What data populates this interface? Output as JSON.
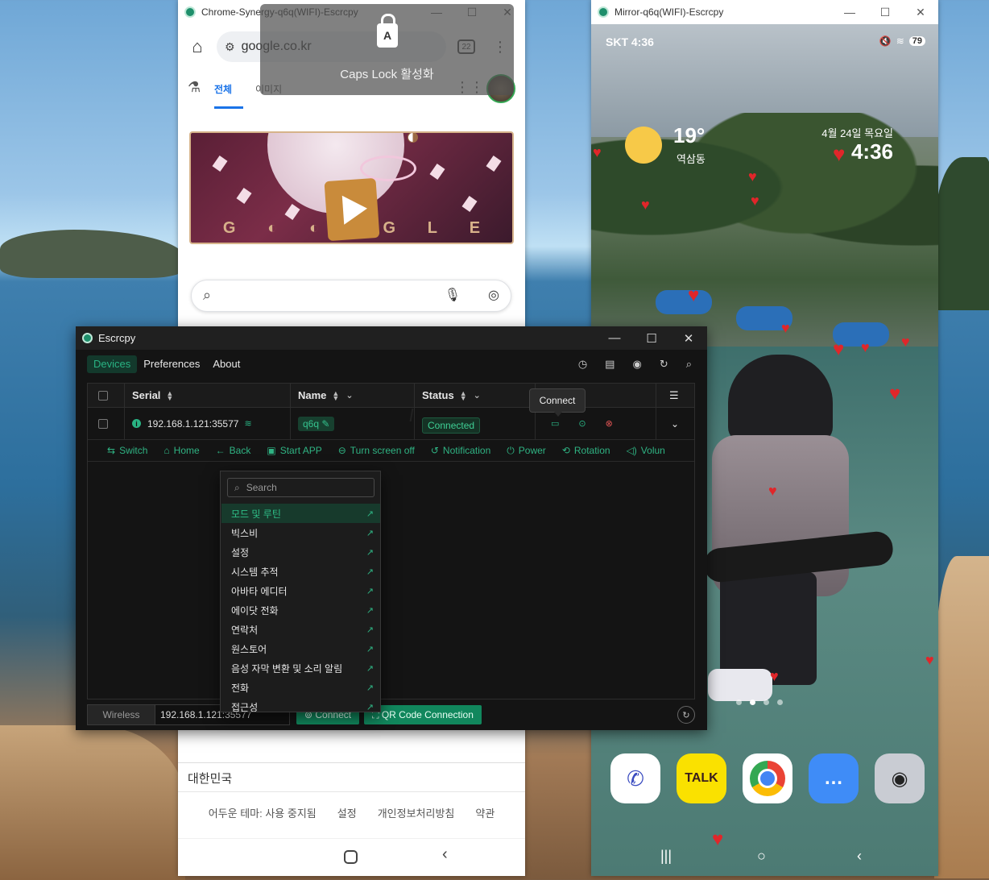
{
  "chrome_window": {
    "title": "Chrome-Synergy-q6q(WIFI)-Escrcpy",
    "url": "google.co.kr",
    "tab_count": "22",
    "tabs": [
      "전체",
      "이미지"
    ],
    "doodle_word": [
      "G",
      "◐",
      "◐",
      "G",
      "L",
      "E"
    ],
    "country": "대한민국",
    "footer_links": [
      "어두운 테마: 사용 중지됨",
      "설정",
      "개인정보처리방침",
      "약관"
    ]
  },
  "capslock_toast": {
    "key_letter": "A",
    "message": "Caps Lock 활성화"
  },
  "mirror_window": {
    "title": "Mirror-q6q(WIFI)-Escrcpy",
    "carrier_time": "SKT 4:36",
    "battery": "79",
    "weather_temp": "19°",
    "weather_location": "역삼동",
    "date": "4월 24일 목요일",
    "clock": "4:36",
    "dock_apps": [
      {
        "name": "phone",
        "icon": "phone-icon",
        "label": ""
      },
      {
        "name": "kakaotalk",
        "icon": "talk-icon",
        "label": "TALK"
      },
      {
        "name": "chrome",
        "icon": "chrome-icon",
        "label": ""
      },
      {
        "name": "messages",
        "icon": "chat-bubble-icon",
        "label": ""
      },
      {
        "name": "camera",
        "icon": "camera-icon",
        "label": ""
      }
    ]
  },
  "escrcpy": {
    "title": "Escrcpy",
    "menu": [
      "Devices",
      "Preferences",
      "About"
    ],
    "active_menu": "Devices",
    "toolbar_icons": [
      "history-icon",
      "terminal-icon",
      "eye-icon",
      "refresh-icon",
      "search-icon"
    ],
    "table": {
      "columns": [
        "Serial",
        "Name",
        "Status"
      ],
      "rows": [
        {
          "serial": "192.168.1.121:35577",
          "name": "q6q",
          "status": "Connected"
        }
      ]
    },
    "tooltip": "Connect",
    "controls": [
      "Switch",
      "Home",
      "Back",
      "Start APP",
      "Turn screen off",
      "Notification",
      "Power",
      "Rotation",
      "Volun"
    ],
    "connect_bar": {
      "mode": "Wireless",
      "ip_value": "192.168.1.121:35577",
      "connect_label": "Connect",
      "qr_label": "QR Code Connection"
    },
    "app_popup": {
      "search_placeholder": "Search",
      "items": [
        "모드 및 루틴",
        "빅스비",
        "설정",
        "시스템 추적",
        "아바타 에디터",
        "에이닷 전화",
        "연락처",
        "원스토어",
        "음성 자막 변환 및 소리 알림",
        "전화",
        "접근성"
      ],
      "highlighted": "모드 및 루틴"
    }
  }
}
